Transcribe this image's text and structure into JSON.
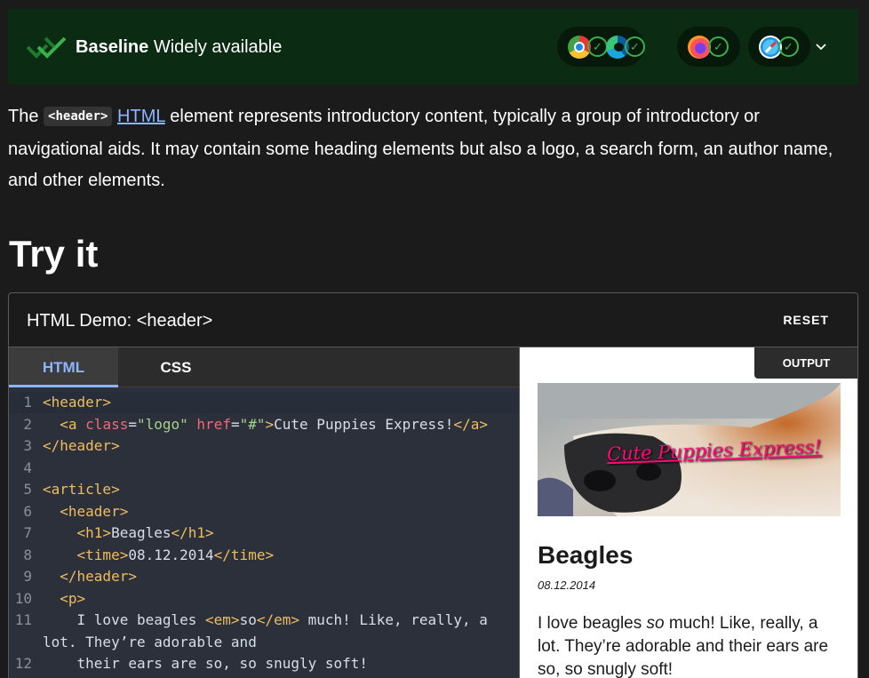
{
  "baseline": {
    "label_bold": "Baseline",
    "label_rest": " Widely available",
    "browsers": [
      {
        "name": "Chrome",
        "icon": "chrome-icon",
        "supported": true
      },
      {
        "name": "Edge",
        "icon": "edge-icon",
        "supported": true
      },
      {
        "name": "Firefox",
        "icon": "firefox-icon",
        "supported": true
      },
      {
        "name": "Safari",
        "icon": "safari-icon",
        "supported": true
      }
    ],
    "check_glyph": "✓"
  },
  "intro": {
    "text_before": "The ",
    "code": "<header>",
    "link": "HTML",
    "text_after": " element represents introductory content, typically a group of introductory or navigational aids. It may contain some heading elements but also a logo, a search form, an author name, and other elements."
  },
  "section_title": "Try it",
  "demo": {
    "title": "HTML Demo: <header>",
    "reset_label": "RESET",
    "tabs": [
      {
        "label": "HTML",
        "active": true
      },
      {
        "label": "CSS",
        "active": false
      }
    ],
    "output_label": "OUTPUT",
    "code_lines": [
      {
        "n": "1",
        "segs": [
          [
            "t",
            "<header>"
          ]
        ]
      },
      {
        "n": "2",
        "segs": [
          [
            "p",
            "  "
          ],
          [
            "t",
            "<a "
          ],
          [
            "a",
            "class"
          ],
          [
            "p",
            "="
          ],
          [
            "s",
            "\"logo\""
          ],
          [
            "p",
            " "
          ],
          [
            "a",
            "href"
          ],
          [
            "p",
            "="
          ],
          [
            "s",
            "\"#\""
          ],
          [
            "t",
            ">"
          ],
          [
            "p",
            "Cute Puppies Express!"
          ],
          [
            "t",
            "</a>"
          ]
        ]
      },
      {
        "n": "3",
        "segs": [
          [
            "t",
            "</header>"
          ]
        ]
      },
      {
        "n": "4",
        "segs": []
      },
      {
        "n": "5",
        "segs": [
          [
            "t",
            "<article>"
          ]
        ]
      },
      {
        "n": "6",
        "segs": [
          [
            "p",
            "  "
          ],
          [
            "t",
            "<header>"
          ]
        ]
      },
      {
        "n": "7",
        "segs": [
          [
            "p",
            "    "
          ],
          [
            "t",
            "<h1>"
          ],
          [
            "p",
            "Beagles"
          ],
          [
            "t",
            "</h1>"
          ]
        ]
      },
      {
        "n": "8",
        "segs": [
          [
            "p",
            "    "
          ],
          [
            "t",
            "<time>"
          ],
          [
            "p",
            "08.12.2014"
          ],
          [
            "t",
            "</time>"
          ]
        ]
      },
      {
        "n": "9",
        "segs": [
          [
            "p",
            "  "
          ],
          [
            "t",
            "</header>"
          ]
        ]
      },
      {
        "n": "10",
        "segs": [
          [
            "p",
            "  "
          ],
          [
            "t",
            "<p>"
          ]
        ]
      },
      {
        "n": "11",
        "segs": [
          [
            "p",
            "    I love beagles "
          ],
          [
            "t",
            "<em>"
          ],
          [
            "p",
            "so"
          ],
          [
            "t",
            "</em>"
          ],
          [
            "p",
            " much! Like, really, a"
          ]
        ]
      },
      {
        "n": "",
        "segs": [
          [
            "p",
            "lot. They’re adorable and"
          ]
        ]
      },
      {
        "n": "12",
        "segs": [
          [
            "p",
            "    their ears are so, so snugly soft!"
          ]
        ]
      }
    ],
    "output": {
      "logo_text": "Cute Puppies Express!",
      "heading": "Beagles",
      "time": "08.12.2014",
      "paragraph_html": "I love beagles <em>so</em> much! Like, really, a lot. They’re adorable and their ears are so, so snugly soft!"
    }
  },
  "colors": {
    "background": "#1b1b1b",
    "baseline_bg": "#0b2b12",
    "accent_link": "#8cb4ff",
    "check_green": "#38b14c",
    "code_tag": "#eebd5f",
    "code_attr": "#ef6b73",
    "code_string": "#a5d189",
    "logo_pink": "#ff0a78"
  }
}
